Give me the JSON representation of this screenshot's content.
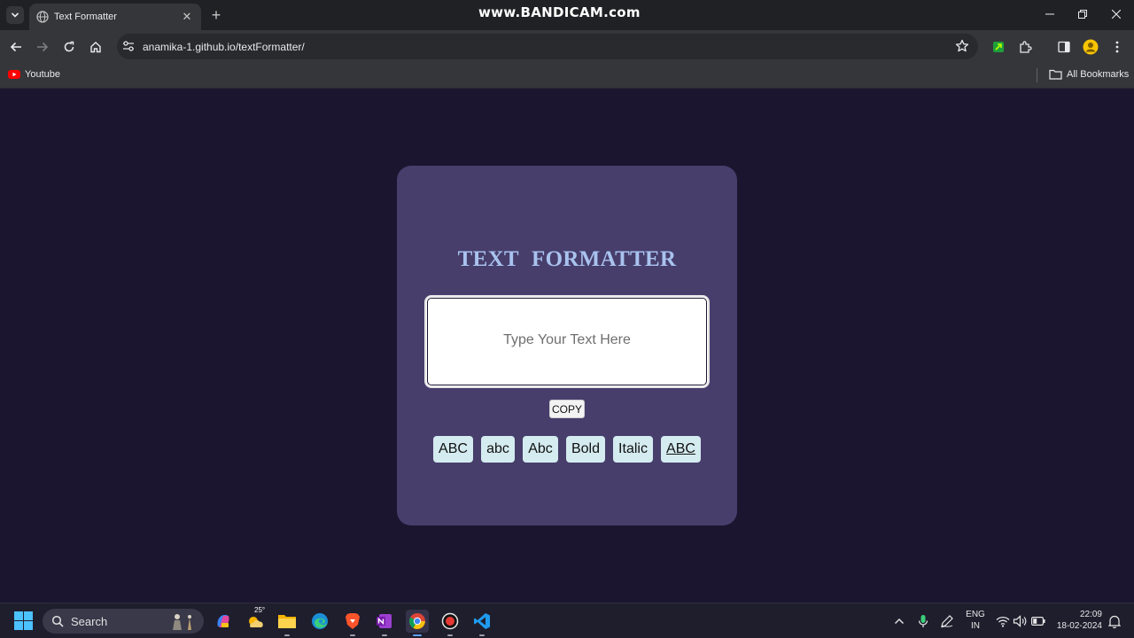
{
  "browser": {
    "tab": {
      "title": "Text Formatter",
      "close_glyph": "✕"
    },
    "new_tab_glyph": "+",
    "watermark": "www.BANDICAM.com",
    "address": {
      "url": "anamika-1.github.io/textFormatter/"
    },
    "bookmarks": [
      {
        "label": "Youtube",
        "icon": "youtube-icon"
      }
    ],
    "all_bookmarks_label": "All Bookmarks"
  },
  "page": {
    "title": "TEXT FORMATTER",
    "input": {
      "placeholder": "Type Your Text Here",
      "value": ""
    },
    "copy_label": "COPY",
    "format_buttons": [
      {
        "label": "ABC",
        "action": "uppercase"
      },
      {
        "label": "abc",
        "action": "lowercase"
      },
      {
        "label": "Abc",
        "action": "capitalize"
      },
      {
        "label": "Bold",
        "action": "bold"
      },
      {
        "label": "Italic",
        "action": "italic"
      },
      {
        "label": "ABC",
        "action": "underline"
      }
    ],
    "colors": {
      "background": "#1b1530",
      "card": "#473e6c",
      "title": "#a9c3ee",
      "button": "#d4ebef"
    }
  },
  "taskbar": {
    "search_label": "Search",
    "weather_temp": "25°",
    "apps": [
      "copilot",
      "weather",
      "file-explorer",
      "edge",
      "brave",
      "onenote",
      "chrome",
      "bandicam",
      "vscode"
    ],
    "language": {
      "line1": "ENG",
      "line2": "IN"
    },
    "clock": {
      "time": "22:09",
      "date": "18-02-2024"
    }
  }
}
